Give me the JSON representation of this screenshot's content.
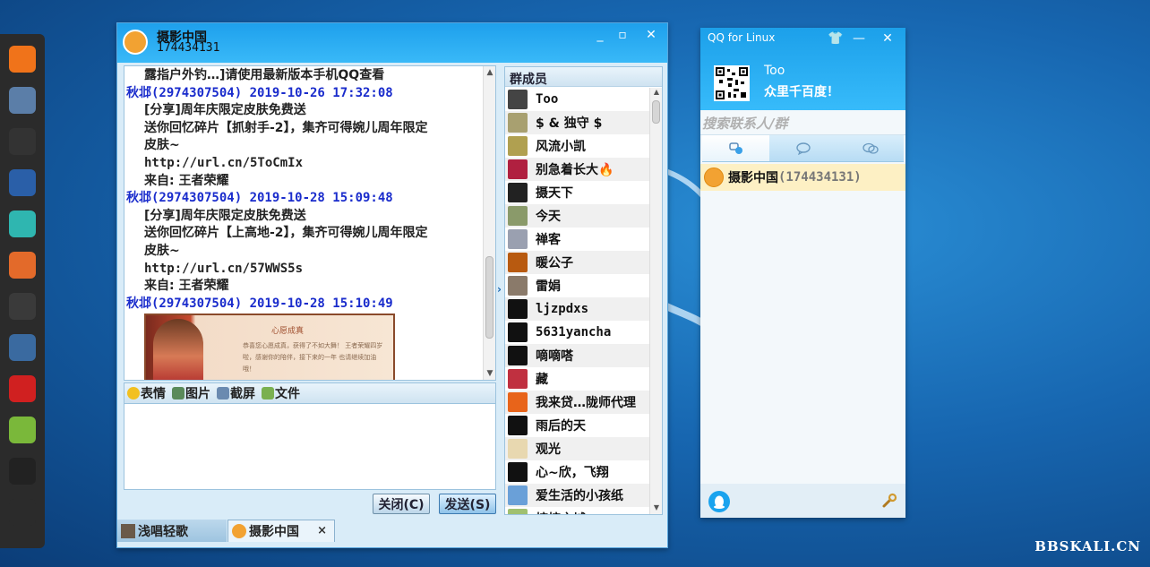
{
  "dock": {
    "items": [
      {
        "name": "firefox-icon",
        "color": "#f0731a"
      },
      {
        "name": "folder-icon",
        "color": "#5b7ea8"
      },
      {
        "name": "terminal-icon",
        "color": "#333333"
      },
      {
        "name": "metasploit-icon",
        "color": "#2a5fa8"
      },
      {
        "name": "anime-app-icon",
        "color": "#2fb6b0"
      },
      {
        "name": "burpsuite-icon",
        "color": "#e36a2a"
      },
      {
        "name": "maltego-icon",
        "color": "#3a3a3a"
      },
      {
        "name": "armitage-icon",
        "color": "#3a6aa0"
      },
      {
        "name": "faraday-icon",
        "color": "#d02020"
      },
      {
        "name": "notes-icon",
        "color": "#7ab83a"
      },
      {
        "name": "qq-penguin-icon",
        "color": "#222222"
      },
      {
        "name": "app-grid-icon",
        "color": "#2b2b2b"
      }
    ]
  },
  "chat": {
    "group_name": "摄影中国",
    "group_number": "174434131",
    "messages": [
      {
        "kind": "body",
        "text": "露指户外钓…]请使用最新版本手机QQ查看"
      },
      {
        "kind": "sender",
        "text": "秋邶(2974307504) 2019-10-26 17:32:08"
      },
      {
        "kind": "body",
        "text": "[分享]周年庆限定皮肤免费送"
      },
      {
        "kind": "body",
        "text": "送你回忆碎片【抓射手-2】，集齐可得婉儿周年限定"
      },
      {
        "kind": "body",
        "text": "皮肤~"
      },
      {
        "kind": "body mono",
        "text": "http://url.cn/5ToCmIx"
      },
      {
        "kind": "body",
        "text": "来自: 王者荣耀"
      },
      {
        "kind": "sender",
        "text": "秋邶(2974307504) 2019-10-28 15:09:48"
      },
      {
        "kind": "body",
        "text": "[分享]周年庆限定皮肤免费送"
      },
      {
        "kind": "body",
        "text": "送你回忆碎片【上高地-2】，集齐可得婉儿周年限定"
      },
      {
        "kind": "body",
        "text": "皮肤~"
      },
      {
        "kind": "body mono",
        "text": "http://url.cn/57WWS5s"
      },
      {
        "kind": "body",
        "text": "来自: 王者荣耀"
      },
      {
        "kind": "sender",
        "text": "秋邶(2974307504) 2019-10-28 15:10:49"
      }
    ],
    "image_card": {
      "title": "心愿成真",
      "text": "恭喜您心愿成真，获得了不如大舞！ 王者荣耀四岁啦，感谢你的陪伴，接下来的一年 也请继续加油哦！"
    },
    "toolbar": {
      "emoji": "表情",
      "image": "图片",
      "screenshot": "截屏",
      "file": "文件"
    },
    "close_label": "关闭(C)",
    "send_label": "发送(S)",
    "tabs": [
      {
        "label": "浅唱轻歌"
      },
      {
        "label": "摄影中国"
      }
    ],
    "tab_close": "×",
    "members_title": "群成员",
    "members": [
      {
        "name": "Too",
        "av": "#444444"
      },
      {
        "name": "$ & 独守 $",
        "av": "#a8a070"
      },
      {
        "name": "风流小凯",
        "av": "#b0a050"
      },
      {
        "name": "别急着长大🔥",
        "av": "#b02040"
      },
      {
        "name": "摄天下",
        "av": "#222222"
      },
      {
        "name": "今天",
        "av": "#8a9a6a"
      },
      {
        "name": "禅客",
        "av": "#9aa0b0"
      },
      {
        "name": "暖公子",
        "av": "#b85a10"
      },
      {
        "name": "雷娟",
        "av": "#8a7a6a"
      },
      {
        "name": "ljzpdxs",
        "av": "#111111"
      },
      {
        "name": "5631yancha",
        "av": "#111111"
      },
      {
        "name": "嘀嘀嗒",
        "av": "#111111"
      },
      {
        "name": "藏",
        "av": "#c03040"
      },
      {
        "name": "我来贷…陇师代理",
        "av": "#e8641a"
      },
      {
        "name": "雨后的天",
        "av": "#111111"
      },
      {
        "name": "观光",
        "av": "#e8d8b0"
      },
      {
        "name": "心~欣，飞翔",
        "av": "#111111"
      },
      {
        "name": "爱生活的小孩纸",
        "av": "#6aa0d8"
      },
      {
        "name": "榕榕之城",
        "av": "#a0c070"
      }
    ]
  },
  "qq": {
    "app_title": "QQ for Linux",
    "nickname": "Too",
    "signature": "众里千百度！",
    "search_placeholder": "搜索联系人/群",
    "group_name": "摄影中国",
    "group_number": "(174434131)"
  },
  "watermark": "BBSKALI.CN"
}
